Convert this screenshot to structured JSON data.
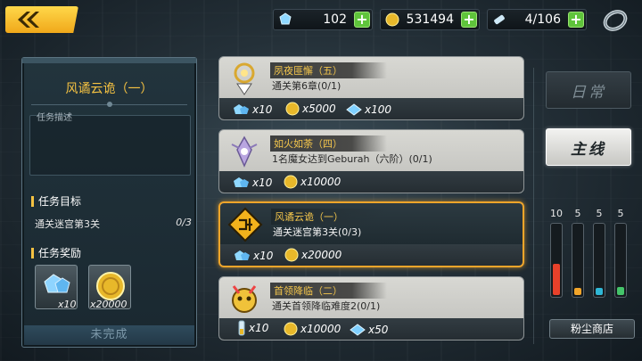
{
  "resources": {
    "crystals": "102",
    "gold": "531494",
    "stamina": "4/106"
  },
  "task_detail": {
    "title": "风谲云诡（一）",
    "desc_label": "任务描述",
    "goal_header": "任务目标",
    "goal_text": "通关迷宫第3关",
    "goal_count": "0/3",
    "reward_header": "任务奖励",
    "rewards": [
      {
        "icon": "crystal-icon",
        "qty": "x10"
      },
      {
        "icon": "gold-coin-icon",
        "qty": "x20000"
      }
    ],
    "status_label": "未完成"
  },
  "quests": [
    {
      "title": "夙夜匪懈（五）",
      "desc": "通关第6章(0/1)",
      "icon": "lamp-emblem-icon",
      "rewards": [
        {
          "icon": "crystal-icon",
          "qty": "x10"
        },
        {
          "icon": "gold-coin-icon",
          "qty": "x5000"
        },
        {
          "icon": "blue-gem-icon",
          "qty": "x100"
        }
      ]
    },
    {
      "title": "如火如荼（四）",
      "desc": "1名魔女达到Geburah（六阶）(0/1)",
      "icon": "witch-emblem-icon",
      "rewards": [
        {
          "icon": "crystal-icon",
          "qty": "x10"
        },
        {
          "icon": "gold-coin-icon",
          "qty": "x10000"
        }
      ]
    },
    {
      "title": "风谲云诡（一）",
      "desc": "通关迷宫第3关(0/3)",
      "icon": "maze-sign-icon",
      "selected": true,
      "rewards": [
        {
          "icon": "crystal-icon",
          "qty": "x10"
        },
        {
          "icon": "gold-coin-icon",
          "qty": "x20000"
        }
      ]
    },
    {
      "title": "首领降临（二）",
      "desc": "通关首领降临难度2(0/1)",
      "icon": "boss-emblem-icon",
      "rewards": [
        {
          "icon": "stamina-tube-icon",
          "qty": "x10"
        },
        {
          "icon": "gold-coin-icon",
          "qty": "x10000"
        },
        {
          "icon": "blue-gem-icon",
          "qty": "x50"
        }
      ]
    }
  ],
  "tabs": {
    "daily": "日常",
    "main": "主线"
  },
  "dust": {
    "counts": [
      "10",
      "5",
      "5",
      "5"
    ],
    "levels": [
      0.45,
      0.1,
      0.1,
      0.12
    ],
    "colors": [
      "#e8412a",
      "#f2a52a",
      "#2fb7d6",
      "#44c46a"
    ]
  },
  "shop_label": "粉尘商店",
  "colors": {
    "accent": "#f5c242",
    "selected_border": "#f0a52a",
    "plus_button": "#5fc43b"
  }
}
